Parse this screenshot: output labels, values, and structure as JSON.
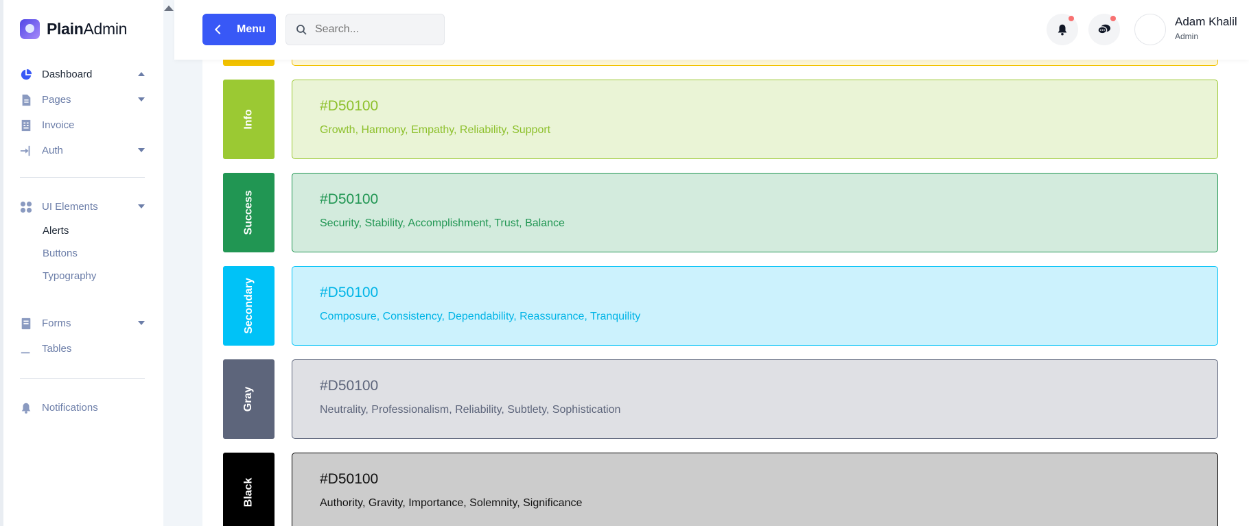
{
  "app": {
    "name_bold": "Plain",
    "name_rest": "Admin"
  },
  "sidebar": {
    "items": [
      {
        "label": "Dashboard",
        "icon": "pie-chart-icon",
        "caret": "up",
        "active": true
      },
      {
        "label": "Pages",
        "icon": "document-icon",
        "caret": "down"
      },
      {
        "label": "Invoice",
        "icon": "invoice-icon"
      },
      {
        "label": "Auth",
        "icon": "login-icon",
        "caret": "down"
      }
    ],
    "ui_elements": {
      "label": "UI Elements",
      "icon": "grid-icon",
      "sub": [
        "Alerts",
        "Buttons",
        "Typography"
      ]
    },
    "forms": {
      "label": "Forms",
      "icon": "form-icon"
    },
    "tables": {
      "label": "Tables",
      "icon": "table-icon"
    },
    "notifications": {
      "label": "Notifications",
      "icon": "bell-icon"
    }
  },
  "header": {
    "menu_label": "Menu",
    "search_placeholder": "Search...",
    "user_name": "Adam Khalil",
    "user_role": "Admin"
  },
  "colors": [
    {
      "name": "Info",
      "hex": "#D50100",
      "words": "Growth, Harmony, Empathy, Reliability, Support",
      "swatch": "#9bc933",
      "bg": "#eaf4d6",
      "border": "#9bc933",
      "text": "#8dc02c"
    },
    {
      "name": "Success",
      "hex": "#D50100",
      "words": "Security, Stability, Accomplishment, Trust, Balance",
      "swatch": "#219653",
      "bg": "#d3ebdd",
      "border": "#219653",
      "text": "#219653"
    },
    {
      "name": "Secondary",
      "hex": "#D50100",
      "words": "Composure, Consistency, Dependability, Reassurance, Tranquility",
      "swatch": "#00c2f7",
      "bg": "#ccf2fd",
      "border": "#00c2f7",
      "text": "#00b4e6"
    },
    {
      "name": "Gray",
      "hex": "#D50100",
      "words": "Neutrality, Professionalism, Reliability, Subtlety, Sophistication",
      "swatch": "#5d657b",
      "bg": "#dfe0e4",
      "border": "#5d657b",
      "text": "#5d657b"
    },
    {
      "name": "Black",
      "hex": "#D50100",
      "words": "Authority, Gravity, Importance, Solemnity, Significance",
      "swatch": "#000000",
      "bg": "#cccccc",
      "border": "#000000",
      "text": "#111111"
    }
  ]
}
